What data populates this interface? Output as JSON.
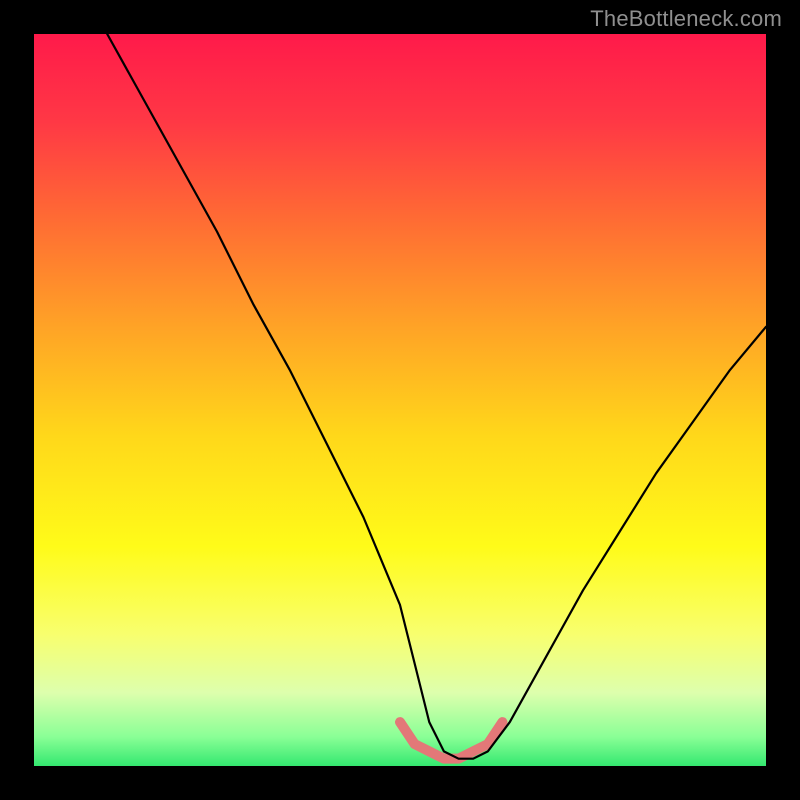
{
  "watermark": "TheBottleneck.com",
  "gradient_stops": [
    {
      "offset": 0.0,
      "color": "#ff1a4a"
    },
    {
      "offset": 0.12,
      "color": "#ff3845"
    },
    {
      "offset": 0.25,
      "color": "#ff6a34"
    },
    {
      "offset": 0.4,
      "color": "#ffa326"
    },
    {
      "offset": 0.55,
      "color": "#ffd81a"
    },
    {
      "offset": 0.7,
      "color": "#fffb19"
    },
    {
      "offset": 0.82,
      "color": "#f8ff6e"
    },
    {
      "offset": 0.9,
      "color": "#ddffad"
    },
    {
      "offset": 0.96,
      "color": "#8aff96"
    },
    {
      "offset": 1.0,
      "color": "#34e870"
    }
  ],
  "chart_data": {
    "type": "line",
    "title": "",
    "xlabel": "",
    "ylabel": "",
    "xlim": [
      0,
      100
    ],
    "ylim": [
      0,
      100
    ],
    "series": [
      {
        "name": "main-curve",
        "x": [
          10,
          15,
          20,
          25,
          30,
          35,
          40,
          45,
          50,
          52,
          54,
          56,
          58,
          60,
          62,
          65,
          70,
          75,
          80,
          85,
          90,
          95,
          100
        ],
        "y": [
          100,
          91,
          82,
          73,
          63,
          54,
          44,
          34,
          22,
          14,
          6,
          2,
          1,
          1,
          2,
          6,
          15,
          24,
          32,
          40,
          47,
          54,
          60
        ]
      },
      {
        "name": "flat-highlight",
        "x": [
          50,
          52,
          54,
          56,
          58,
          60,
          62,
          64
        ],
        "y": [
          6,
          3,
          2,
          1,
          1,
          2,
          3,
          6
        ]
      }
    ]
  },
  "curve_style": {
    "main_stroke": "#000000",
    "main_width": 2.2,
    "highlight_stroke": "#e37878",
    "highlight_width": 10
  }
}
